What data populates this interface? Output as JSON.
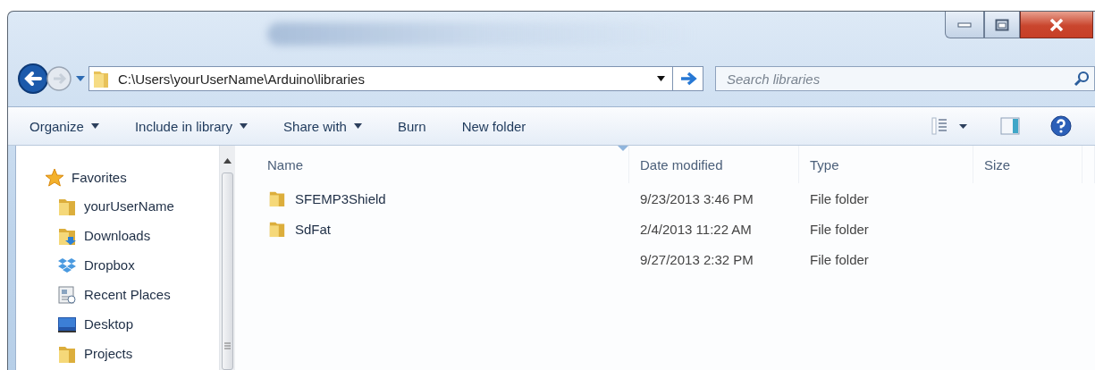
{
  "address": {
    "path": "C:\\Users\\yourUserName\\Arduino\\libraries"
  },
  "search": {
    "placeholder": "Search libraries"
  },
  "toolbar": [
    {
      "label": "Organize",
      "dropdown": true
    },
    {
      "label": "Include in library",
      "dropdown": true
    },
    {
      "label": "Share with",
      "dropdown": true
    },
    {
      "label": "Burn",
      "dropdown": false
    },
    {
      "label": "New folder",
      "dropdown": false
    }
  ],
  "sidebar": {
    "items": [
      {
        "label": "Favorites",
        "kind": "star",
        "children": [
          {
            "label": "yourUserName",
            "kind": "folder"
          },
          {
            "label": "Downloads",
            "kind": "downloads"
          },
          {
            "label": "Dropbox",
            "kind": "dropbox"
          },
          {
            "label": "Recent Places",
            "kind": "recent"
          },
          {
            "label": "Desktop",
            "kind": "desktop"
          },
          {
            "label": "Projects",
            "kind": "folder"
          }
        ]
      }
    ]
  },
  "table": {
    "columns": [
      {
        "label": "Name",
        "sorted": true
      },
      {
        "label": "Date modified",
        "sorted": false
      },
      {
        "label": "Type",
        "sorted": false
      },
      {
        "label": "Size",
        "sorted": false
      }
    ],
    "rows": [
      {
        "name": "SFEMP3Shield",
        "date": "9/23/2013 3:46 PM",
        "type": "File folder"
      },
      {
        "name": "SdFat",
        "date": "2/4/2013 11:22 AM",
        "type": "File folder"
      },
      {
        "date": "9/27/2013 2:32 PM",
        "type": "File folder"
      }
    ]
  }
}
